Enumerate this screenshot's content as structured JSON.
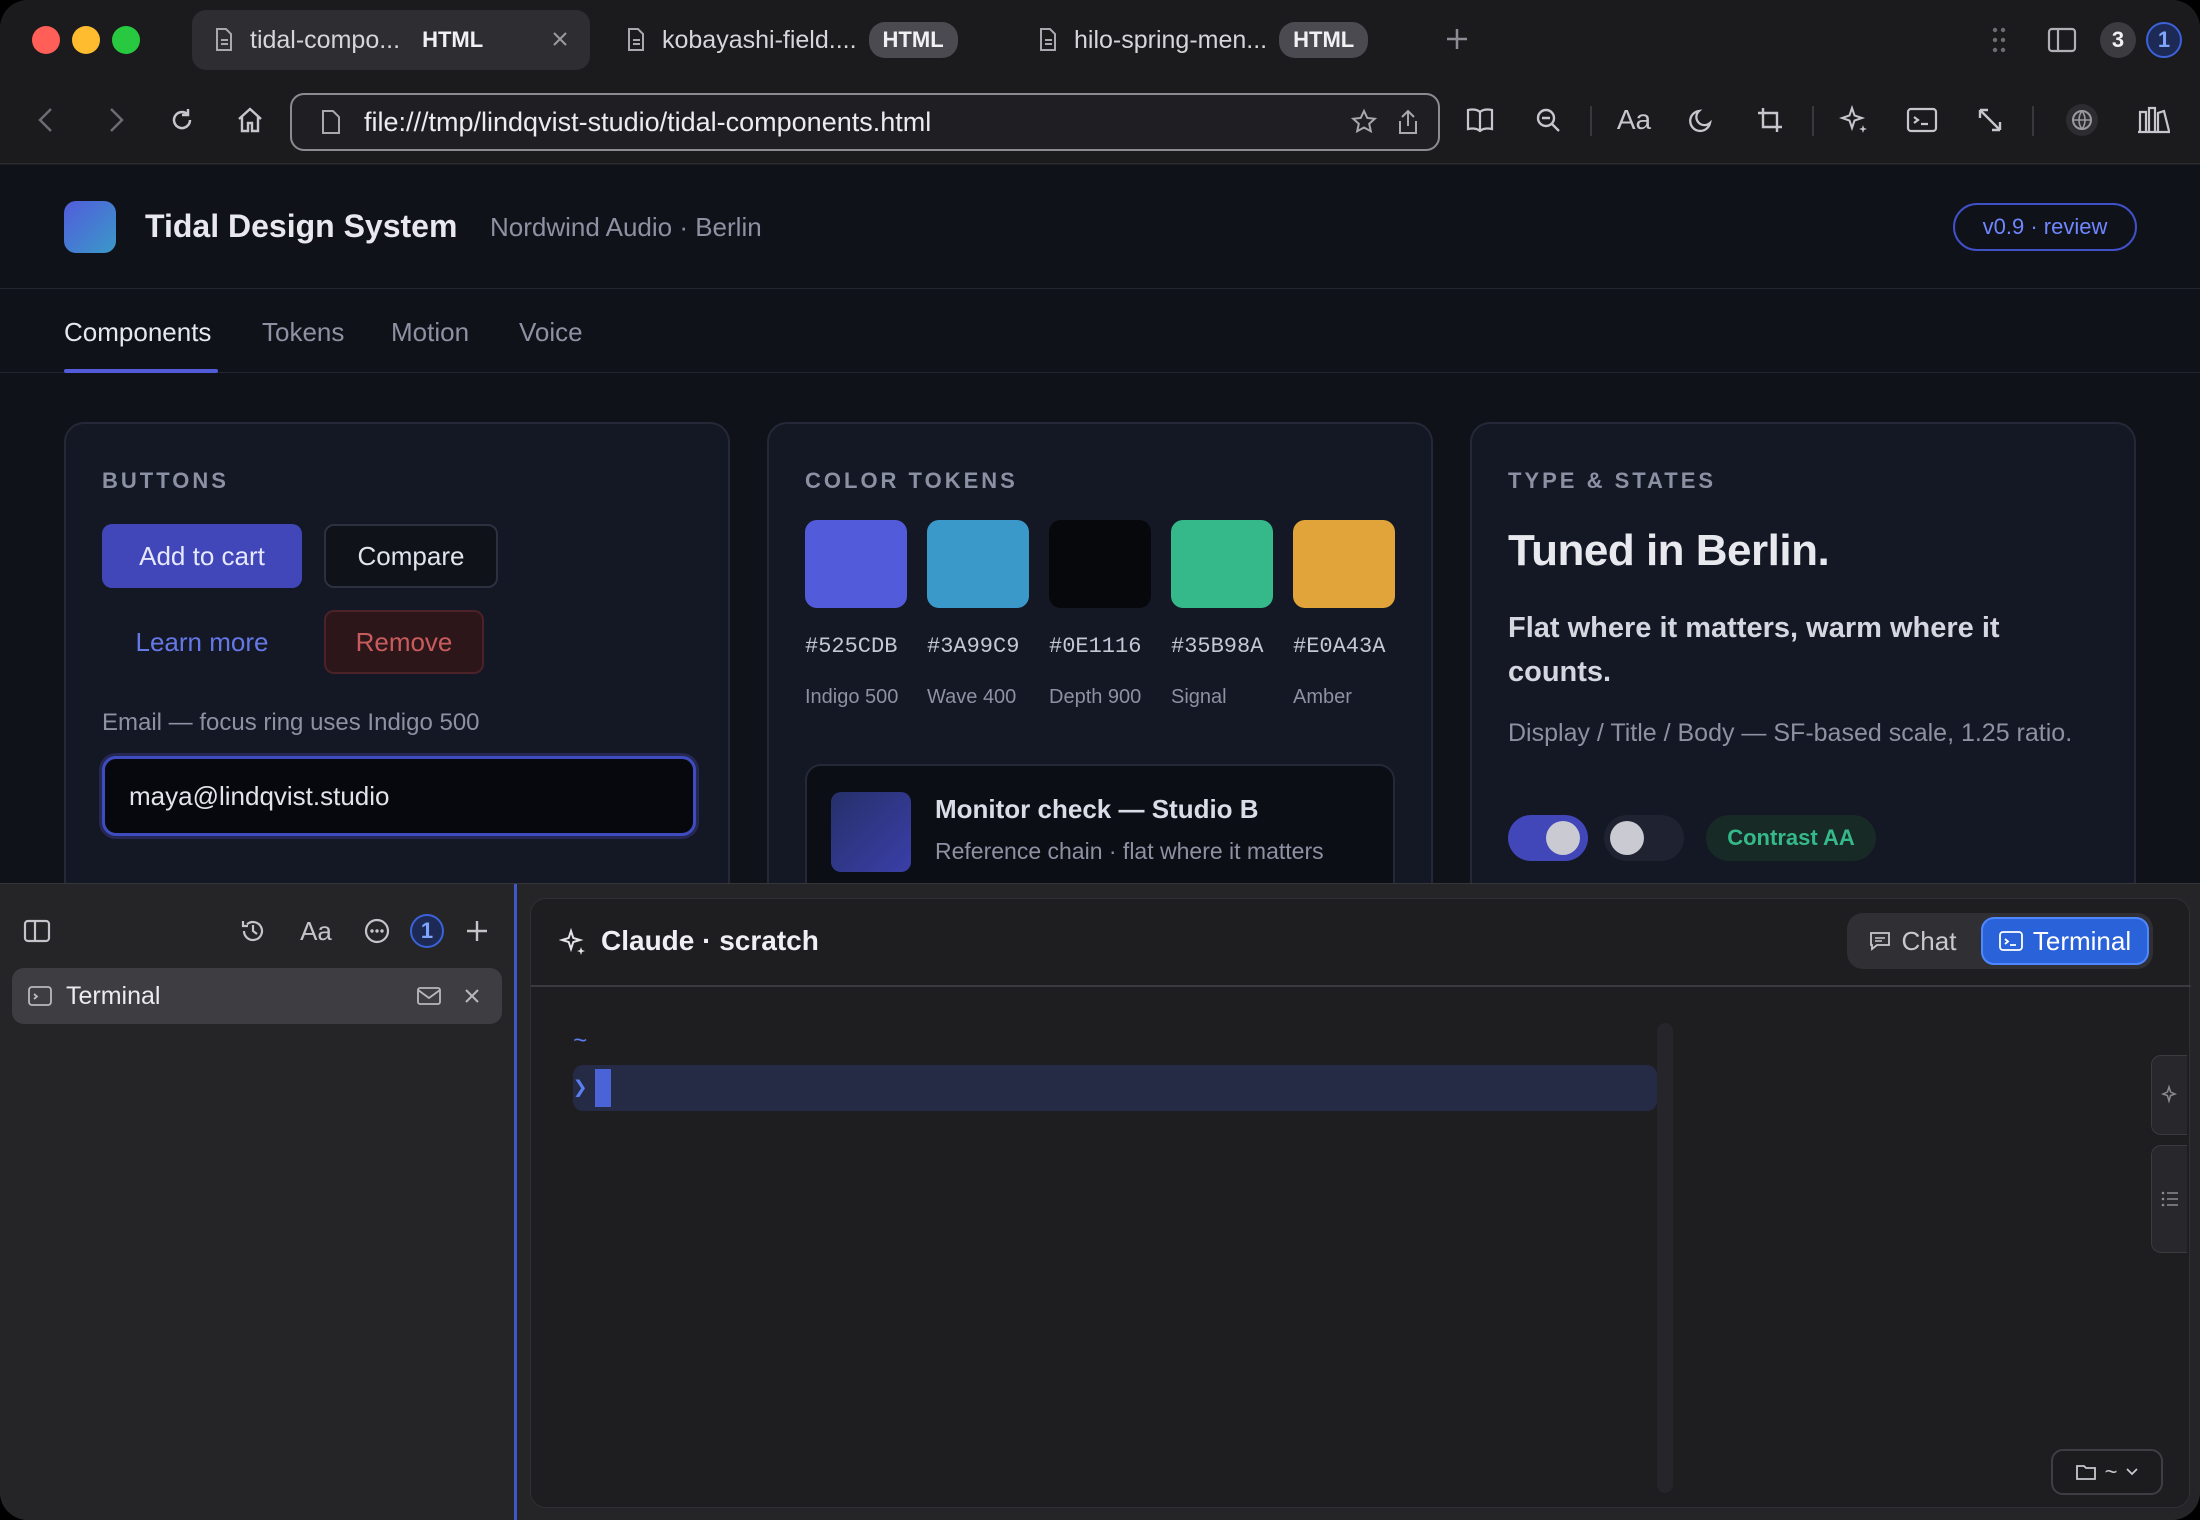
{
  "browser": {
    "tabs": [
      {
        "title": "tidal-compo...",
        "badge": "HTML"
      },
      {
        "title": "kobayashi-field....",
        "badge": "HTML"
      },
      {
        "title": "hilo-spring-men...",
        "badge": "HTML"
      }
    ],
    "tab_count": "3",
    "profile_count": "1",
    "url": "file:///tmp/lindqvist-studio/tidal-components.html",
    "font_toggle_label": "Aa"
  },
  "site": {
    "title": "Tidal Design System",
    "subtitle": "Nordwind Audio · Berlin",
    "version": "v0.9 · review",
    "nav": [
      "Components",
      "Tokens",
      "Motion",
      "Voice"
    ],
    "active_nav": "Components"
  },
  "buttons_card": {
    "title": "BUTTONS",
    "primary": "Add to cart",
    "secondary": "Compare",
    "link": "Learn more",
    "danger": "Remove",
    "email_label": "Email — focus ring uses Indigo 500",
    "email_value": "maya@lindqvist.studio"
  },
  "tokens_card": {
    "title": "COLOR TOKENS",
    "swatches": [
      {
        "hex": "#525CDB",
        "name": "Indigo 500",
        "color": "#525CDB"
      },
      {
        "hex": "#3A99C9",
        "name": "Wave 400",
        "color": "#3A99C9"
      },
      {
        "hex": "#0E1116",
        "name": "Depth 900",
        "color": "#0E1116"
      },
      {
        "hex": "#35B98A",
        "name": "Signal",
        "color": "#35B98A"
      },
      {
        "hex": "#E0A43A",
        "name": "Amber",
        "color": "#E0A43A"
      }
    ],
    "monitor_title": "Monitor check — Studio B",
    "monitor_sub": "Reference chain · flat where it matters"
  },
  "type_card": {
    "title": "TYPE & STATES",
    "display": "Tuned in Berlin.",
    "title_text": "Flat where it matters, warm where it counts.",
    "body": "Display / Title / Body — SF-based scale, 1.25 ratio.",
    "badge": "Contrast AA"
  },
  "dock": {
    "font_label": "Aa",
    "badge_count": "1",
    "terminal_item": "Terminal",
    "pane_title": "Claude · scratch",
    "seg_chat": "Chat",
    "seg_terminal": "Terminal",
    "tilde": "~",
    "prompt": "❯",
    "folder_label": "~"
  },
  "colors": {
    "accent": "#525CDB",
    "terminal_active": "#2962d9"
  }
}
